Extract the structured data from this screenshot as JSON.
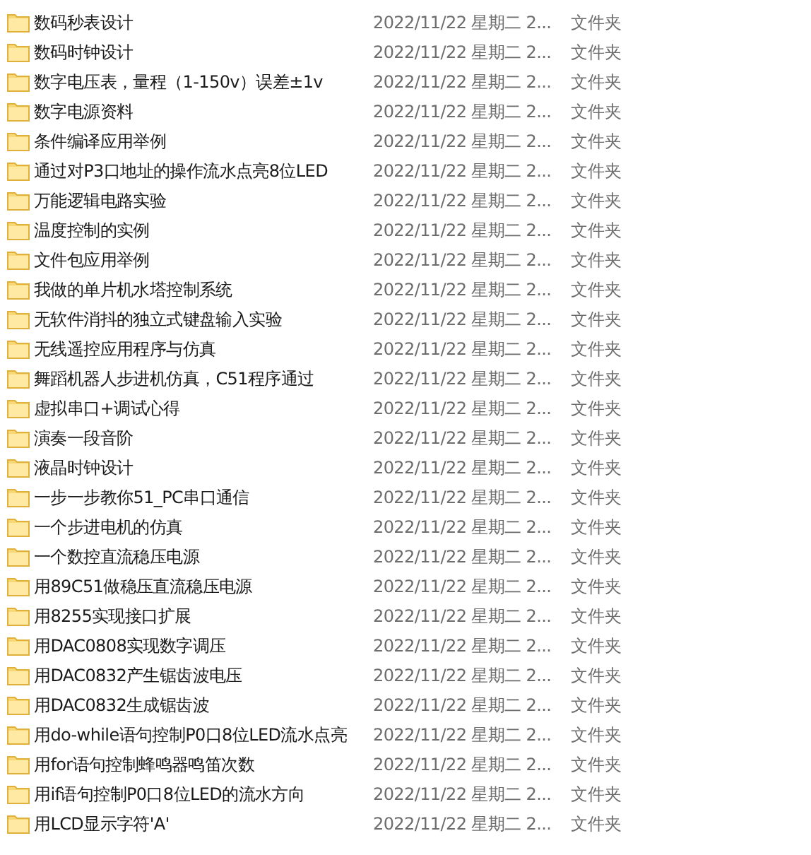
{
  "files": [
    {
      "name": "数码秒表设计",
      "date": "2022/11/22 星期二 2...",
      "type": "文件夹"
    },
    {
      "name": "数码时钟设计",
      "date": "2022/11/22 星期二 2...",
      "type": "文件夹"
    },
    {
      "name": "数字电压表，量程（1-150v）误差±1v",
      "date": "2022/11/22 星期二 2...",
      "type": "文件夹"
    },
    {
      "name": "数字电源资料",
      "date": "2022/11/22 星期二 2...",
      "type": "文件夹"
    },
    {
      "name": "条件编译应用举例",
      "date": "2022/11/22 星期二 2...",
      "type": "文件夹"
    },
    {
      "name": "通过对P3口地址的操作流水点亮8位LED",
      "date": "2022/11/22 星期二 2...",
      "type": "文件夹"
    },
    {
      "name": "万能逻辑电路实验",
      "date": "2022/11/22 星期二 2...",
      "type": "文件夹"
    },
    {
      "name": "温度控制的实例",
      "date": "2022/11/22 星期二 2...",
      "type": "文件夹"
    },
    {
      "name": "文件包应用举例",
      "date": "2022/11/22 星期二 2...",
      "type": "文件夹"
    },
    {
      "name": "我做的单片机水塔控制系统",
      "date": "2022/11/22 星期二 2...",
      "type": "文件夹"
    },
    {
      "name": "无软件消抖的独立式键盘输入实验",
      "date": "2022/11/22 星期二 2...",
      "type": "文件夹"
    },
    {
      "name": "无线遥控应用程序与仿真",
      "date": "2022/11/22 星期二 2...",
      "type": "文件夹"
    },
    {
      "name": "舞蹈机器人步进机仿真，C51程序通过",
      "date": "2022/11/22 星期二 2...",
      "type": "文件夹"
    },
    {
      "name": "虚拟串口+调试心得",
      "date": "2022/11/22 星期二 2...",
      "type": "文件夹"
    },
    {
      "name": "演奏一段音阶",
      "date": "2022/11/22 星期二 2...",
      "type": "文件夹"
    },
    {
      "name": "液晶时钟设计",
      "date": "2022/11/22 星期二 2...",
      "type": "文件夹"
    },
    {
      "name": "一步一步教你51_PC串口通信",
      "date": "2022/11/22 星期二 2...",
      "type": "文件夹"
    },
    {
      "name": "一个步进电机的仿真",
      "date": "2022/11/22 星期二 2...",
      "type": "文件夹"
    },
    {
      "name": "一个数控直流稳压电源",
      "date": "2022/11/22 星期二 2...",
      "type": "文件夹"
    },
    {
      "name": "用89C51做稳压直流稳压电源",
      "date": "2022/11/22 星期二 2...",
      "type": "文件夹"
    },
    {
      "name": "用8255实现接口扩展",
      "date": "2022/11/22 星期二 2...",
      "type": "文件夹"
    },
    {
      "name": "用DAC0808实现数字调压",
      "date": "2022/11/22 星期二 2...",
      "type": "文件夹"
    },
    {
      "name": "用DAC0832产生锯齿波电压",
      "date": "2022/11/22 星期二 2...",
      "type": "文件夹"
    },
    {
      "name": "用DAC0832生成锯齿波",
      "date": "2022/11/22 星期二 2...",
      "type": "文件夹"
    },
    {
      "name": "用do-while语句控制P0口8位LED流水点亮",
      "date": "2022/11/22 星期二 2...",
      "type": "文件夹"
    },
    {
      "name": "用for语句控制蜂鸣器鸣笛次数",
      "date": "2022/11/22 星期二 2...",
      "type": "文件夹"
    },
    {
      "name": "用if语句控制P0口8位LED的流水方向",
      "date": "2022/11/22 星期二 2...",
      "type": "文件夹"
    },
    {
      "name": "用LCD显示字符'A'",
      "date": "2022/11/22 星期二 2...",
      "type": "文件夹"
    }
  ]
}
